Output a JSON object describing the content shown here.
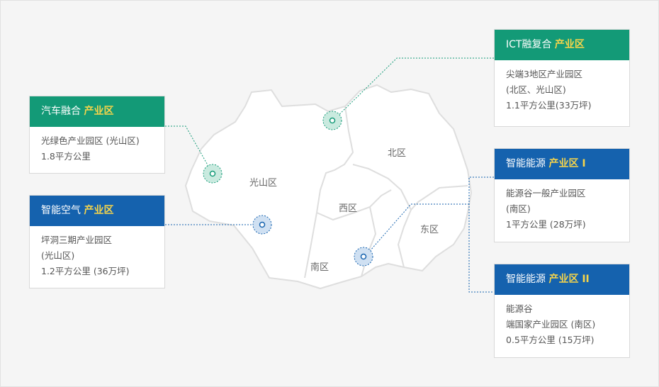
{
  "districts": {
    "gwangsan": "光山区",
    "buk": "北区",
    "seo": "西区",
    "dong": "东区",
    "nam": "南区"
  },
  "colors": {
    "green": "#139a77",
    "blue": "#1562ae",
    "highlight": "#f7d54a"
  },
  "cards": {
    "auto": {
      "title": "汽车融合",
      "title_hl": "产业区",
      "lines": [
        "光绿色产业园区 (光山区)",
        "1.8平方公里"
      ]
    },
    "air": {
      "title": "智能空气",
      "title_hl": "产业区",
      "lines": [
        "坪洞三期产业园区",
        " (光山区)",
        "1.2平方公里 (36万坪)"
      ]
    },
    "ict": {
      "title": "ICT融复合",
      "title_hl": "产业区",
      "lines": [
        "尖端3地区产业园区",
        "(北区、光山区)",
        "1.1平方公里(33万坪)"
      ]
    },
    "energy1": {
      "title": "智能能源",
      "title_hl": "产业区 I",
      "lines": [
        "能源谷一般产业园区",
        "(南区)",
        "1平方公里 (28万坪)"
      ]
    },
    "energy2": {
      "title": "智能能源",
      "title_hl": "产业区 II",
      "lines": [
        "能源谷",
        "端国家产业园区 (南区)",
        "0.5平方公里 (15万坪)"
      ]
    }
  }
}
